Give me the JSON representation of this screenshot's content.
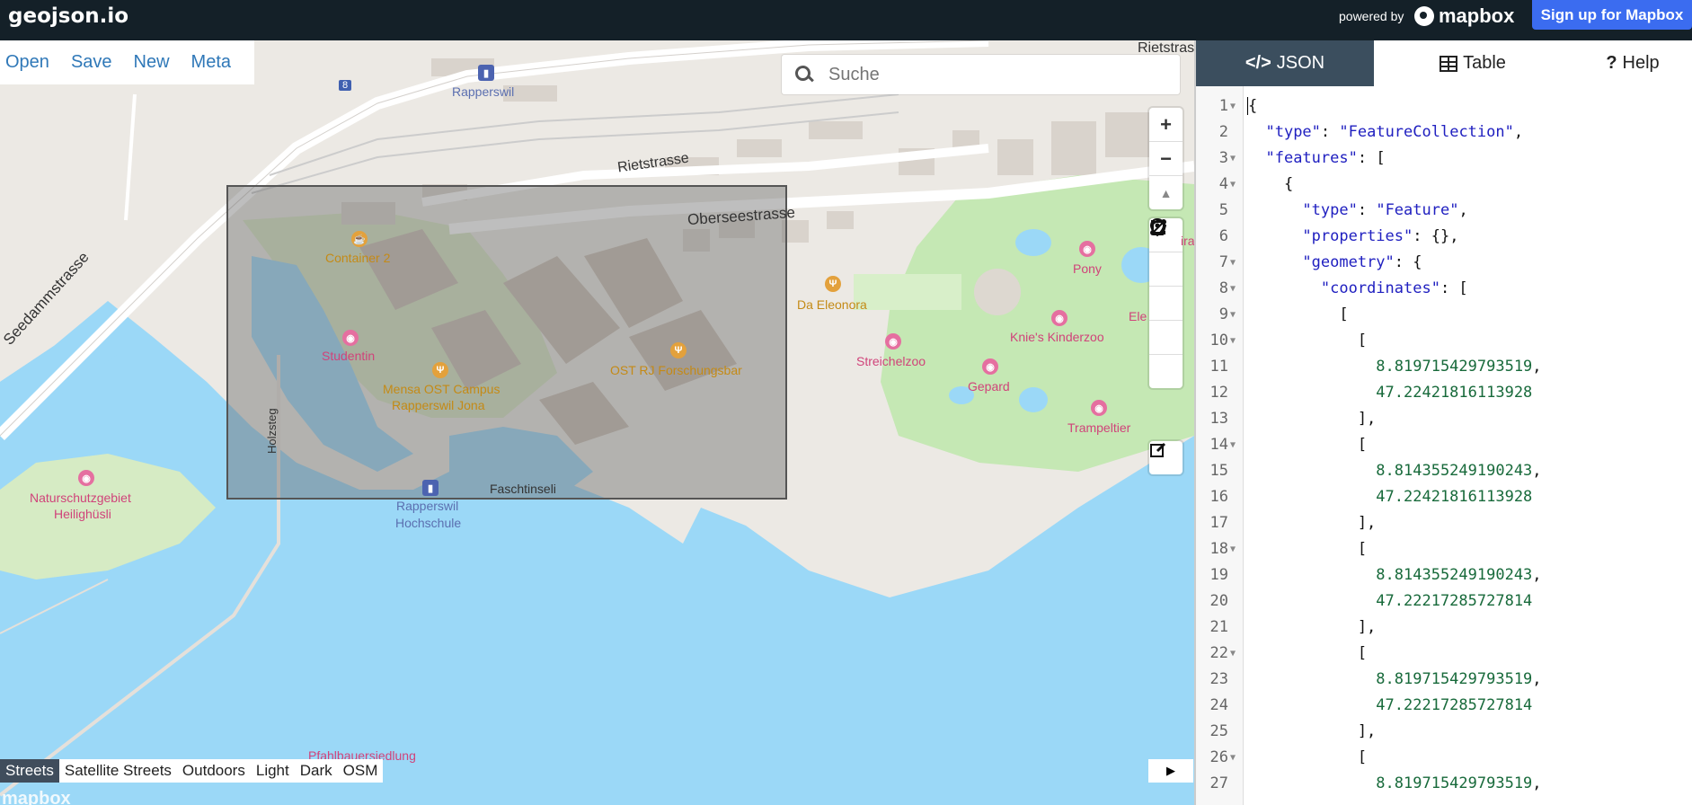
{
  "app": {
    "logo": "geojson.io",
    "powered_by": "powered by",
    "mapbox_brand": "mapbox",
    "signup": "Sign up for Mapbox"
  },
  "menu": [
    "Open",
    "Save",
    "New",
    "Meta"
  ],
  "search": {
    "placeholder": "Suche"
  },
  "map_controls": {
    "zoom_in": "+",
    "zoom_out": "−",
    "compass": "▲",
    "tools": [
      "marker-icon",
      "line-icon",
      "polygon-icon",
      "rectangle-icon",
      "circle-icon"
    ],
    "edit": "edit-icon"
  },
  "map_labels": {
    "road_rietstrasse": "Rietstrasse",
    "road_rietstrasse_top": "Rietstras",
    "road_oberseestrasse": "Oberseestrasse",
    "road_seedammstrasse": "Seedammstrasse",
    "road_holzsteg": "Holzsteg",
    "route_number": "8",
    "rapperswil_station": "Rapperswil",
    "container2": "Container 2",
    "studentin": "Studentin",
    "mensa_line1": "Mensa OST Campus",
    "mensa_line2": "Rapperswil Jona",
    "ost_bar": "OST RJ Forschungsbar",
    "da_eleonora": "Da Eleonora",
    "streichelzoo": "Streichelzoo",
    "gepard": "Gepard",
    "knies_kinderzoo": "Knie's Kinderzoo",
    "pony": "Pony",
    "trampeltier": "Trampeltier",
    "elefant": "Ele",
    "giraffe": "iraffe",
    "naturschutz_line1": "Naturschutzgebiet",
    "naturschutz_line2": "Heilighüsli",
    "hochschule_line1": "Rapperswil",
    "hochschule_line2": "Hochschule",
    "faschtinseli": "Faschtinseli",
    "pfahlbauer": "Pfahlbauersiedlung"
  },
  "map_styles": [
    "Streets",
    "Satellite Streets",
    "Outdoors",
    "Light",
    "Dark",
    "OSM"
  ],
  "active_style": "Streets",
  "collapse_button": "▶",
  "watermark": "mapbox",
  "tabs": [
    {
      "label": "JSON",
      "icon": "code-icon"
    },
    {
      "label": "Table",
      "icon": "table-icon"
    },
    {
      "label": "Help",
      "icon": "question-icon"
    }
  ],
  "code_lines": [
    {
      "n": "1",
      "fold": true,
      "text": "{"
    },
    {
      "n": "2",
      "fold": false,
      "text": "  \"type\": \"FeatureCollection\","
    },
    {
      "n": "3",
      "fold": true,
      "text": "  \"features\": ["
    },
    {
      "n": "4",
      "fold": true,
      "text": "    {"
    },
    {
      "n": "5",
      "fold": false,
      "text": "      \"type\": \"Feature\","
    },
    {
      "n": "6",
      "fold": false,
      "text": "      \"properties\": {},"
    },
    {
      "n": "7",
      "fold": true,
      "text": "      \"geometry\": {"
    },
    {
      "n": "8",
      "fold": true,
      "text": "        \"coordinates\": ["
    },
    {
      "n": "9",
      "fold": true,
      "text": "          ["
    },
    {
      "n": "10",
      "fold": true,
      "text": "            ["
    },
    {
      "n": "11",
      "fold": false,
      "text": "              8.819715429793519,"
    },
    {
      "n": "12",
      "fold": false,
      "text": "              47.22421816113928"
    },
    {
      "n": "13",
      "fold": false,
      "text": "            ],"
    },
    {
      "n": "14",
      "fold": true,
      "text": "            ["
    },
    {
      "n": "15",
      "fold": false,
      "text": "              8.814355249190243,"
    },
    {
      "n": "16",
      "fold": false,
      "text": "              47.22421816113928"
    },
    {
      "n": "17",
      "fold": false,
      "text": "            ],"
    },
    {
      "n": "18",
      "fold": true,
      "text": "            ["
    },
    {
      "n": "19",
      "fold": false,
      "text": "              8.814355249190243,"
    },
    {
      "n": "20",
      "fold": false,
      "text": "              47.22217285727814"
    },
    {
      "n": "21",
      "fold": false,
      "text": "            ],"
    },
    {
      "n": "22",
      "fold": true,
      "text": "            ["
    },
    {
      "n": "23",
      "fold": false,
      "text": "              8.819715429793519,"
    },
    {
      "n": "24",
      "fold": false,
      "text": "              47.22217285727814"
    },
    {
      "n": "25",
      "fold": false,
      "text": "            ],"
    },
    {
      "n": "26",
      "fold": true,
      "text": "            ["
    },
    {
      "n": "27",
      "fold": false,
      "text": "              8.819715429793519,"
    }
  ],
  "colors": {
    "topbar": "#142028",
    "signup": "#3b6cf0",
    "water": "#9bd8f7",
    "land": "#ece9e4",
    "park": "#c5e8b4",
    "tab_active": "#3b4e5e"
  }
}
